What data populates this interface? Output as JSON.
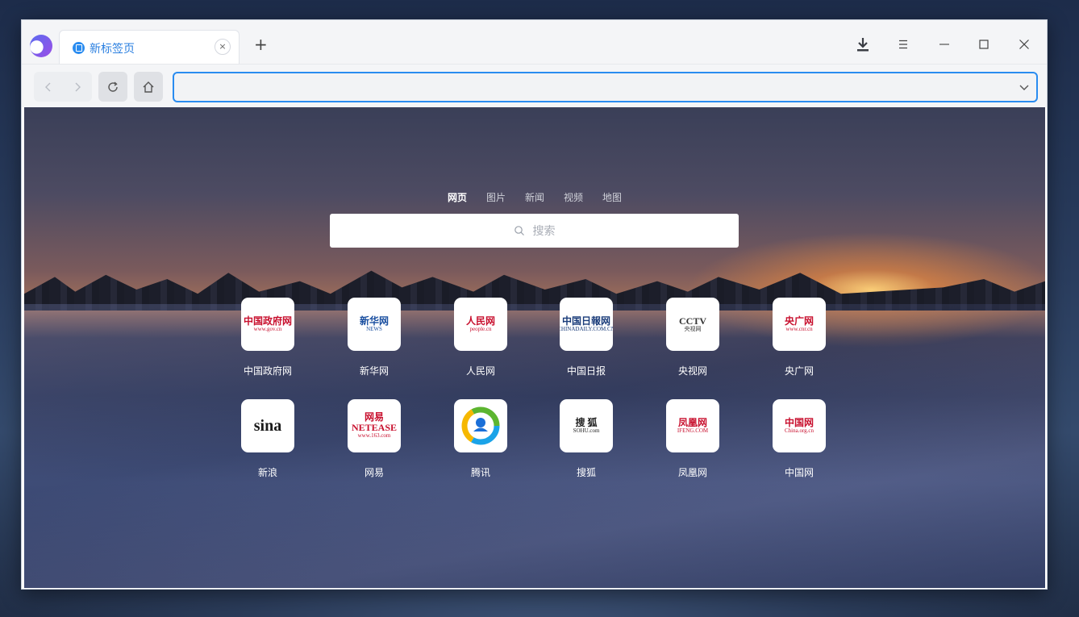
{
  "window": {
    "tab_title": "新标签页",
    "tab_close": "×",
    "new_tab": "+"
  },
  "toolbar": {
    "download_label": "下载",
    "menu_label": "菜单"
  },
  "address_bar": {
    "value": "",
    "placeholder": ""
  },
  "search": {
    "tabs": [
      {
        "label": "网页",
        "active": true
      },
      {
        "label": "图片",
        "active": false
      },
      {
        "label": "新闻",
        "active": false
      },
      {
        "label": "视频",
        "active": false
      },
      {
        "label": "地图",
        "active": false
      }
    ],
    "placeholder": "搜索"
  },
  "sites": [
    {
      "label": "中国政府网",
      "logo_lines": [
        "中国政府网",
        "www.gov.cn"
      ],
      "color": "#c8102e"
    },
    {
      "label": "新华网",
      "logo_lines": [
        "新华网",
        "NEWS"
      ],
      "color": "#1a4fa0"
    },
    {
      "label": "人民网",
      "logo_lines": [
        "人民网",
        "people.cn"
      ],
      "color": "#c8102e"
    },
    {
      "label": "中国日报",
      "logo_lines": [
        "中国日報网",
        "CHINADAILY.COM.CN"
      ],
      "color": "#1a3c7a"
    },
    {
      "label": "央视网",
      "logo_lines": [
        "CCTV",
        "央视网"
      ],
      "color": "#333333"
    },
    {
      "label": "央广网",
      "logo_lines": [
        "央广网",
        "www.cnr.cn"
      ],
      "color": "#c8102e"
    },
    {
      "label": "新浪",
      "logo_lines": [
        "sina"
      ],
      "color": "#1a1a1a"
    },
    {
      "label": "网易",
      "logo_lines": [
        "网易 NETEASE",
        "www.163.com"
      ],
      "color": "#c8102e"
    },
    {
      "label": "腾讯",
      "logo_lines": [],
      "color": "#1aa3e8"
    },
    {
      "label": "搜狐",
      "logo_lines": [
        "搜 狐",
        "SOHU.com"
      ],
      "color": "#222222"
    },
    {
      "label": "凤凰网",
      "logo_lines": [
        "凤凰网",
        "IFENG.COM"
      ],
      "color": "#c8102e"
    },
    {
      "label": "中国网",
      "logo_lines": [
        "中国网",
        "China.org.cn"
      ],
      "color": "#c8102e"
    }
  ]
}
